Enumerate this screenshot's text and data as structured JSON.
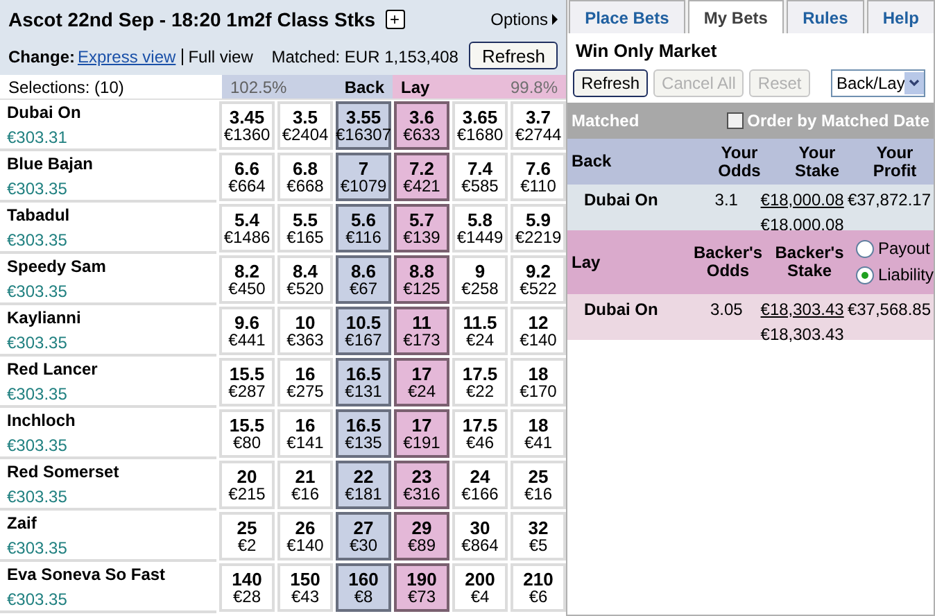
{
  "market": {
    "title": "Ascot 22nd Sep - 18:20 1m2f Class Stks",
    "expand_icon": "+",
    "options": "Options",
    "change_label": "Change:",
    "views": [
      {
        "label": "Express view",
        "selected": false
      },
      {
        "label": "Full view",
        "selected": true
      }
    ],
    "matched": "Matched: EUR 1,153,408",
    "refresh": "Refresh",
    "selections": "Selections: (10)",
    "back_pct": "102.5%",
    "back_label": "Back",
    "lay_label": "Lay",
    "lay_pct": "99.8%"
  },
  "runners": [
    {
      "name": "Dubai On",
      "pl": "€303.31",
      "prices": [
        [
          "3.45",
          "€1360"
        ],
        [
          "3.5",
          "€2404"
        ],
        [
          "3.55",
          "€16307"
        ],
        [
          "3.6",
          "€633"
        ],
        [
          "3.65",
          "€1680"
        ],
        [
          "3.7",
          "€2744"
        ]
      ]
    },
    {
      "name": "Blue Bajan",
      "pl": "€303.35",
      "prices": [
        [
          "6.6",
          "€664"
        ],
        [
          "6.8",
          "€668"
        ],
        [
          "7",
          "€1079"
        ],
        [
          "7.2",
          "€421"
        ],
        [
          "7.4",
          "€585"
        ],
        [
          "7.6",
          "€110"
        ]
      ]
    },
    {
      "name": "Tabadul",
      "pl": "€303.35",
      "prices": [
        [
          "5.4",
          "€1486"
        ],
        [
          "5.5",
          "€165"
        ],
        [
          "5.6",
          "€116"
        ],
        [
          "5.7",
          "€139"
        ],
        [
          "5.8",
          "€1449"
        ],
        [
          "5.9",
          "€2219"
        ]
      ]
    },
    {
      "name": "Speedy Sam",
      "pl": "€303.35",
      "prices": [
        [
          "8.2",
          "€450"
        ],
        [
          "8.4",
          "€520"
        ],
        [
          "8.6",
          "€67"
        ],
        [
          "8.8",
          "€125"
        ],
        [
          "9",
          "€258"
        ],
        [
          "9.2",
          "€522"
        ]
      ]
    },
    {
      "name": "Kaylianni",
      "pl": "€303.35",
      "prices": [
        [
          "9.6",
          "€441"
        ],
        [
          "10",
          "€363"
        ],
        [
          "10.5",
          "€167"
        ],
        [
          "11",
          "€173"
        ],
        [
          "11.5",
          "€24"
        ],
        [
          "12",
          "€140"
        ]
      ]
    },
    {
      "name": "Red Lancer",
      "pl": "€303.35",
      "prices": [
        [
          "15.5",
          "€287"
        ],
        [
          "16",
          "€275"
        ],
        [
          "16.5",
          "€131"
        ],
        [
          "17",
          "€24"
        ],
        [
          "17.5",
          "€22"
        ],
        [
          "18",
          "€170"
        ]
      ]
    },
    {
      "name": "Inchloch",
      "pl": "€303.35",
      "prices": [
        [
          "15.5",
          "€80"
        ],
        [
          "16",
          "€141"
        ],
        [
          "16.5",
          "€135"
        ],
        [
          "17",
          "€191"
        ],
        [
          "17.5",
          "€46"
        ],
        [
          "18",
          "€41"
        ]
      ]
    },
    {
      "name": "Red Somerset",
      "pl": "€303.35",
      "prices": [
        [
          "20",
          "€215"
        ],
        [
          "21",
          "€16"
        ],
        [
          "22",
          "€181"
        ],
        [
          "23",
          "€316"
        ],
        [
          "24",
          "€166"
        ],
        [
          "25",
          "€16"
        ]
      ]
    },
    {
      "name": "Zaif",
      "pl": "€303.35",
      "prices": [
        [
          "25",
          "€2"
        ],
        [
          "26",
          "€140"
        ],
        [
          "27",
          "€30"
        ],
        [
          "29",
          "€89"
        ],
        [
          "30",
          "€864"
        ],
        [
          "32",
          "€5"
        ]
      ]
    },
    {
      "name": "Eva Soneva So Fast",
      "pl": "€303.35",
      "prices": [
        [
          "140",
          "€28"
        ],
        [
          "150",
          "€43"
        ],
        [
          "160",
          "€8"
        ],
        [
          "190",
          "€73"
        ],
        [
          "200",
          "€4"
        ],
        [
          "210",
          "€6"
        ]
      ]
    }
  ],
  "tabs": [
    {
      "label": "Place Bets",
      "selected": false
    },
    {
      "label": "My Bets",
      "selected": true
    },
    {
      "label": "Rules",
      "selected": false
    },
    {
      "label": "Help",
      "selected": false
    }
  ],
  "my_bets": {
    "title": "Win Only Market",
    "buttons": [
      {
        "label": "Refresh",
        "disabled": false
      },
      {
        "label": "Cancel All",
        "disabled": true
      },
      {
        "label": "Reset",
        "disabled": true
      }
    ],
    "view_select": "Back/Lay",
    "matched": "Matched",
    "order_by": {
      "label": "Order by Matched Date",
      "checked": false
    },
    "back": {
      "label": "Back",
      "columns": [
        "Your Odds",
        "Your Stake",
        "Your Profit"
      ],
      "bets": [
        {
          "name": "Dubai On",
          "odds": "3.1",
          "stake": "€18,000.08",
          "stake_total": "€18,000.08",
          "profit": "€37,872.17"
        }
      ]
    },
    "lay": {
      "label": "Lay",
      "columns": [
        "Backer's Odds",
        "Backer's Stake"
      ],
      "options": [
        {
          "label": "Payout",
          "selected": false
        },
        {
          "label": "Liability",
          "selected": true
        }
      ],
      "bets": [
        {
          "name": "Dubai On",
          "odds": "3.05",
          "stake": "€18,303.43",
          "stake_total": "€18,303.43",
          "profit": "€37,568.85"
        }
      ]
    }
  }
}
